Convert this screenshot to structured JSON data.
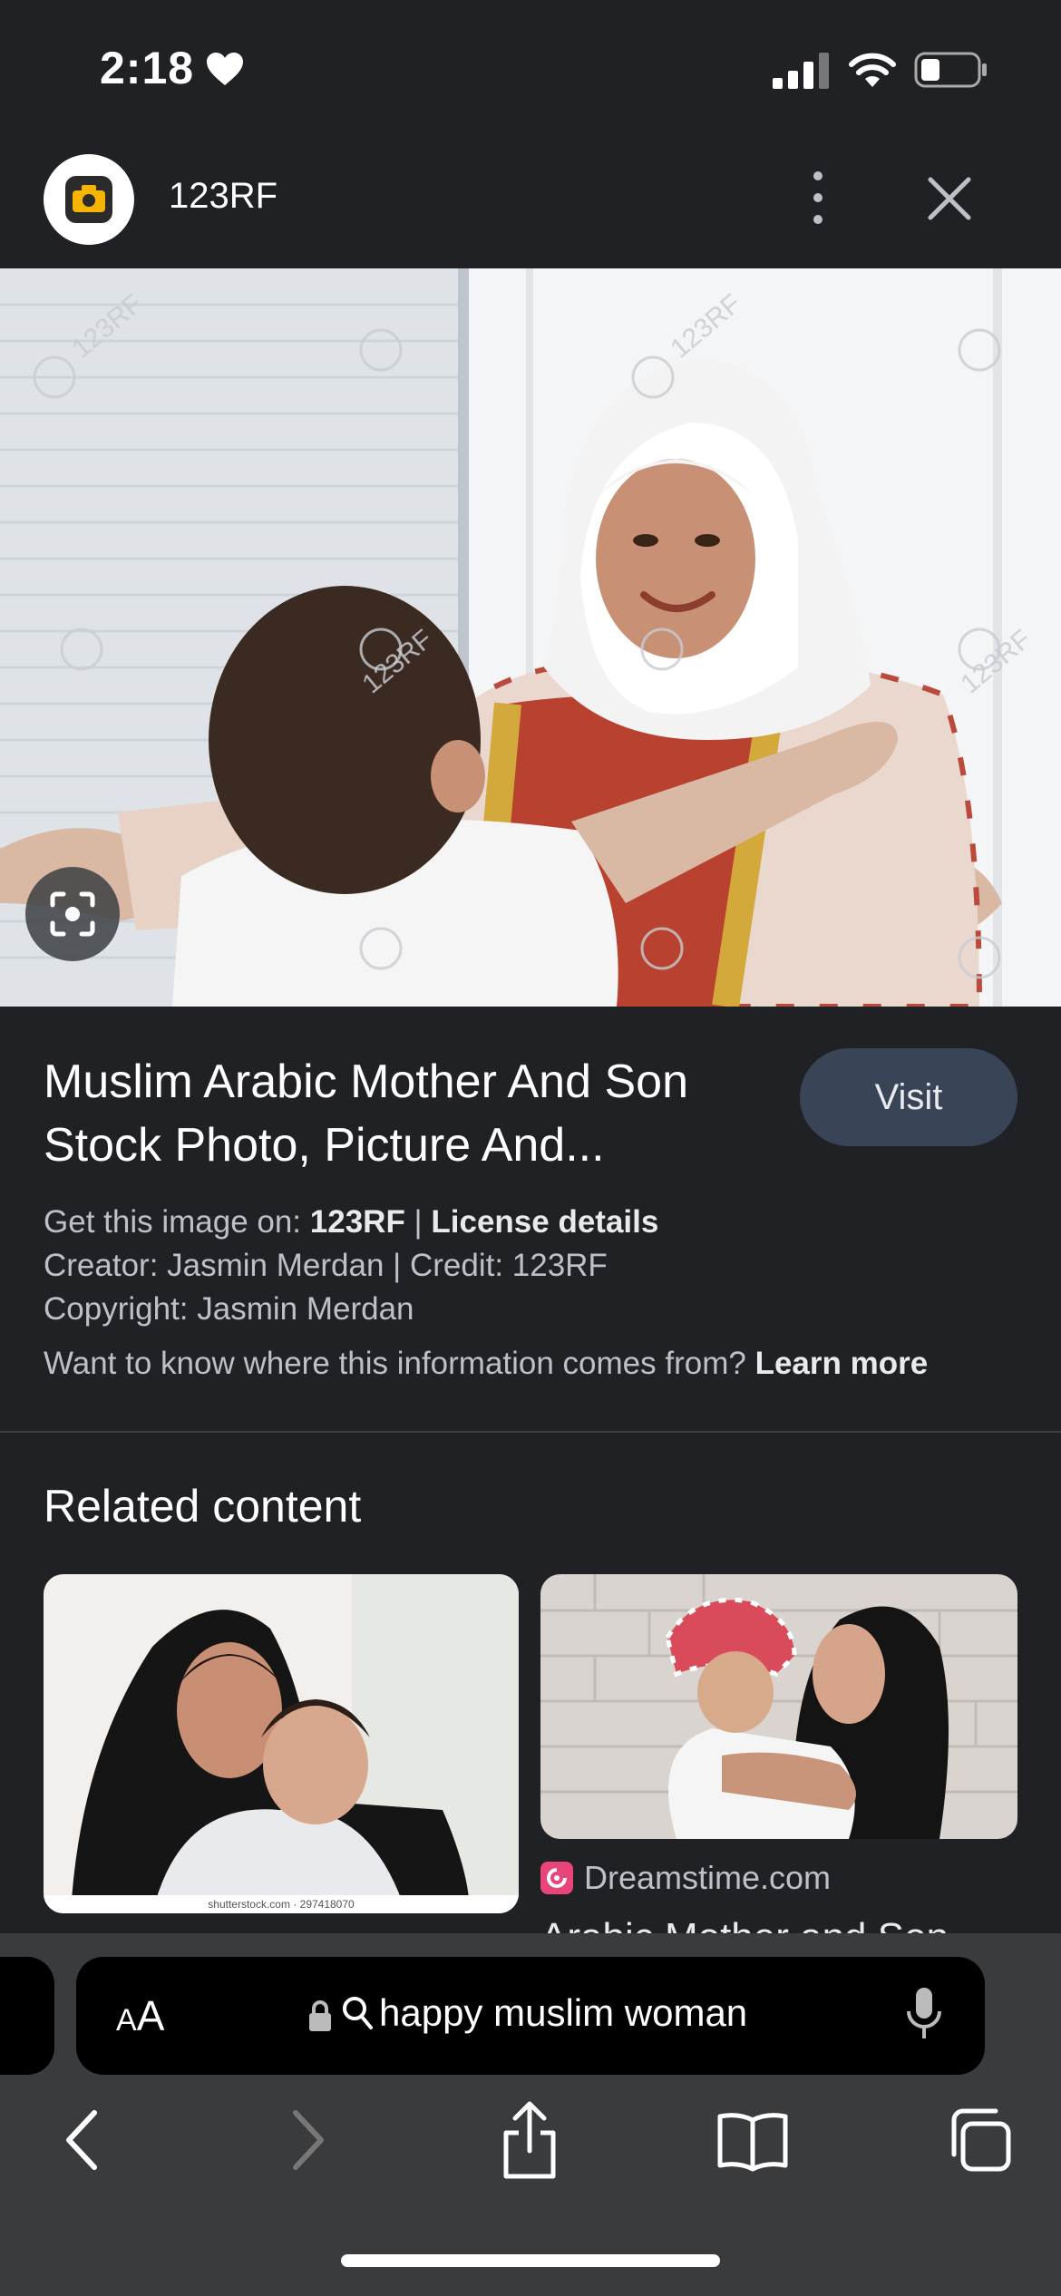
{
  "status_bar": {
    "time": "2:18"
  },
  "site": {
    "name": "123RF"
  },
  "image": {
    "title_line1": "Muslim Arabic Mother And Son",
    "title_line2": "Stock Photo, Picture And...",
    "watermark": "123RF"
  },
  "actions": {
    "visit_label": "Visit"
  },
  "details": {
    "get_image_prefix": "Get this image on: ",
    "get_image_source": "123RF",
    "get_image_sep": " | ",
    "license_details": "License details",
    "creator_credit": "Creator: Jasmin Merdan | Credit: 123RF",
    "copyright": "Copyright: Jasmin Merdan",
    "info_question": "Want to know where this information comes from? ",
    "learn_more": "Learn more"
  },
  "related": {
    "heading": "Related content",
    "items": [
      {
        "watermark": "shutterstock.com · 297418070"
      },
      {
        "source": "Dreamstime.com",
        "title": "Arabic Mother and Son"
      }
    ]
  },
  "address_bar": {
    "aa_label_small": "A",
    "aa_label_large": "A",
    "query": "happy muslim woman"
  },
  "colors": {
    "background": "#202124",
    "visit_button": "#394457",
    "toolbar": "#3a3b3d"
  }
}
